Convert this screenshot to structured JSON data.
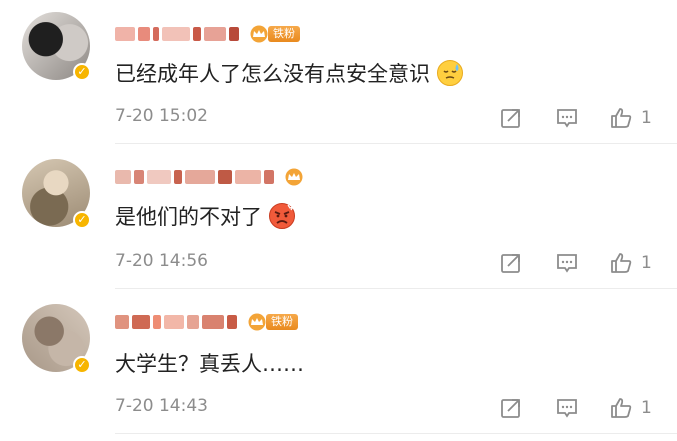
{
  "comments": [
    {
      "content": "已经成年人了怎么没有点安全意识",
      "emoji": "sweat-emoji",
      "timestamp": "7-20 15:02",
      "likes": "1",
      "fan_tag": "铁粉",
      "avatar_colors": [
        "#2b2b2b",
        "#d8d3cf"
      ]
    },
    {
      "content": "是他们的不对了",
      "emoji": "angry-emoji",
      "timestamp": "7-20 14:56",
      "likes": "1",
      "fan_tag": "",
      "avatar_colors": [
        "#c6b7a1",
        "#8f7e6d"
      ]
    },
    {
      "content": "大学生？真丢人……",
      "emoji": "",
      "timestamp": "7-20 14:43",
      "likes": "1",
      "fan_tag": "铁粉",
      "avatar_colors": [
        "#b7a89a",
        "#6c5a4c"
      ]
    }
  ],
  "icons": {
    "share": "share-icon",
    "reply": "comment-icon",
    "like": "thumbs-up-icon",
    "crown": "crown-icon",
    "verified": "verified-badge-icon"
  },
  "colors": {
    "meta_text": "#8c8c8c",
    "badge_orange": "#f7b500",
    "divider": "#ececec"
  }
}
